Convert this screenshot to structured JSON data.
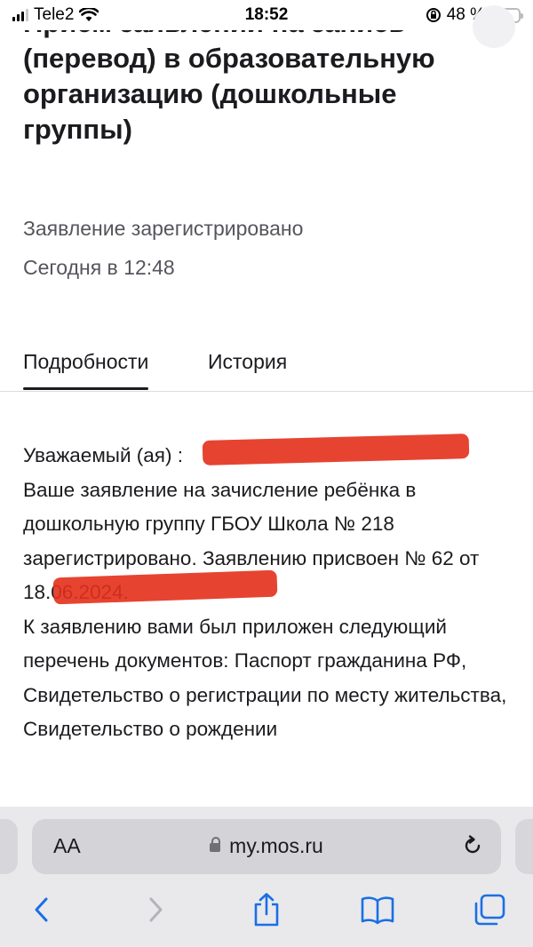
{
  "status_bar": {
    "carrier": "Tele2",
    "time": "18:52",
    "battery": "48 %"
  },
  "page": {
    "title": "Прием заявлений на запись (перевод) в образовательную организацию (дошкольные группы)",
    "status": "Заявление зарегистрировано",
    "date": "Сегодня в 12:48"
  },
  "tabs": [
    {
      "label": "Подробности",
      "active": true
    },
    {
      "label": "История",
      "active": false
    }
  ],
  "message": {
    "text": "Уважаемый (ая)                                           :\nВаше заявление на зачисление ребёнка в дошкольную группу ГБОУ Школа № 218 зарегистрировано. Заявлению присвоен №                           62 от 18.06.2024.\n К заявлению вами был приложен следующий перечень документов: Паспорт гражданина РФ, Свидетельство о регистрации по месту жительства, Свидетельство о рождении"
  },
  "browser": {
    "aa_label": "AA",
    "url": "my.mos.ru"
  },
  "colors": {
    "accent": "#1a6fe3",
    "redaction": "#e3301b",
    "battery": "#f6c32a"
  }
}
